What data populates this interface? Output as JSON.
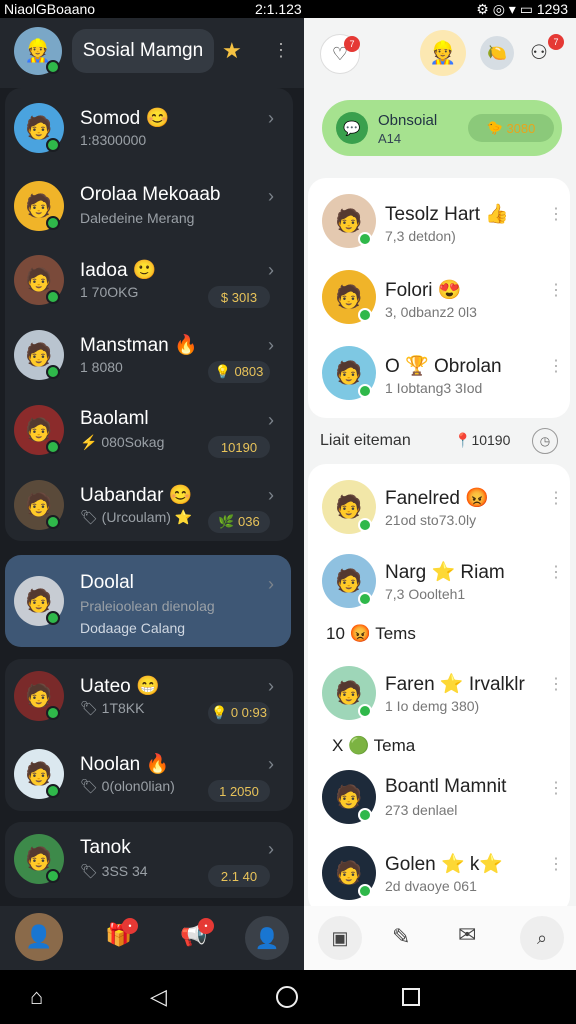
{
  "status": {
    "left": "NiaolGBoaano",
    "center": "2:1.123",
    "right": "1293"
  },
  "app": {
    "title": "Sosial Mamgn"
  },
  "left_list": [
    {
      "name": "Somod",
      "sub": "1:8300000",
      "emoji": "😊",
      "pill": "",
      "color": "#4aa3df"
    },
    {
      "name": "Orolaa Mekoaab",
      "sub": "Daledeine Merang",
      "emoji": "",
      "pill": "",
      "color": "#f0b429"
    },
    {
      "name": "Iadoa",
      "sub": "1 70OKG",
      "emoji": "🙂",
      "pill": "$ 30I3",
      "color": "#7a4a3a"
    },
    {
      "name": "Manstman",
      "sub": "1 8080",
      "emoji": "🔥",
      "pill": "💡 0803",
      "color": "#b9c4cf"
    },
    {
      "name": "Baolaml",
      "sub": "⚡ 080Sokag",
      "emoji": "",
      "pill": "10190",
      "color": "#8b2b2b"
    },
    {
      "name": "Uabandar",
      "sub": "🏷 (Urcoulam) ⭐",
      "emoji": "😊",
      "pill": "🌿 036",
      "color": "#5a4a3a"
    },
    {
      "name": "Doolal",
      "sub": "Praleioolean dienolag",
      "sub2": "Dodaage Calang",
      "emoji": "",
      "pill": "",
      "color": "#c7ccd3"
    },
    {
      "name": "Uateo",
      "sub": "🏷 1T8KK",
      "emoji": "😁",
      "pill": "💡 0 0:93",
      "color": "#7a2a2a"
    },
    {
      "name": "Noolan",
      "sub": "🏷 0(olon0lian)",
      "emoji": "🔥",
      "pill": "1 2050",
      "color": "#dbe8ef"
    },
    {
      "name": "Tanok",
      "sub": "🏷 3SS 34",
      "emoji": "",
      "pill": "2.1 40",
      "color": "#3d8a4a"
    }
  ],
  "right_promo": {
    "title": "Obnsoial",
    "sub": "A14",
    "button": "3080"
  },
  "right_top": [
    {
      "name": "Tesolz Hart 👍",
      "sub": "7,3 detdon)",
      "color": "#e4c9b0"
    },
    {
      "name": "Folori 😍",
      "sub": "3, 0dbanz2 0l3",
      "color": "#f0b429"
    },
    {
      "name": "O 🏆 Obrolan",
      "sub": "1 Iobtang3 3Iod",
      "color": "#7ec8e3"
    }
  ],
  "section_title": "Liait eiteman",
  "section_badge": "10190",
  "right_list": [
    {
      "name": "Fanelred 😡",
      "sub": "21od sto73.0ly",
      "color": "#f2e7a8"
    },
    {
      "name": "Narg ⭐ Riam",
      "sub": "7,3 Ooolteh1",
      "color": "#8fc1e0"
    },
    {
      "name": "Faren ⭐ Irvalklr",
      "sub": "1 Io demg 380)",
      "color": "#9ed6b8"
    },
    {
      "name": "Boantl Mamnit",
      "sub": "273 denlael",
      "color": "#1d2a3a"
    },
    {
      "name": "Golen ⭐ k⭐",
      "sub": "2d dvaoye 061",
      "color": "#1d2a3a"
    }
  ],
  "section_labels": [
    {
      "text": "10 😡 Tems"
    },
    {
      "text": "X 🟢 Tema"
    }
  ]
}
